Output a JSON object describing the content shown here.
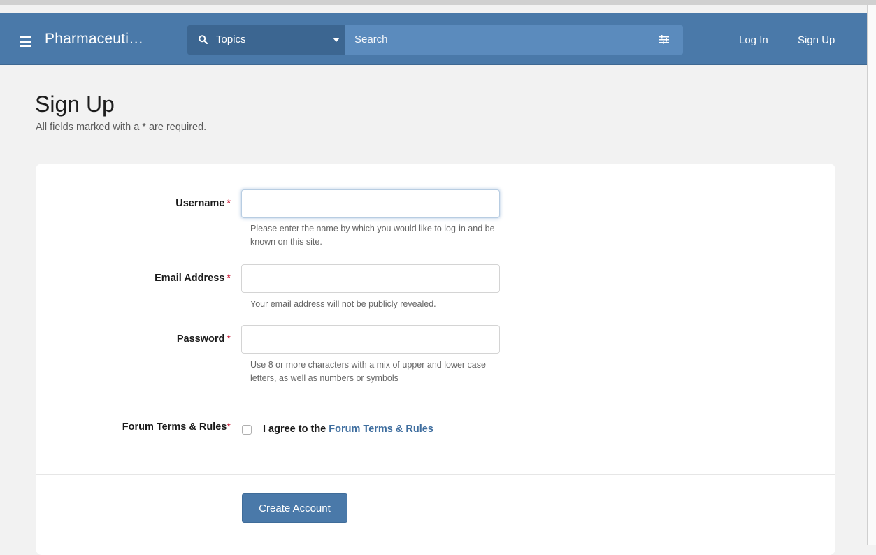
{
  "header": {
    "site_title": "Pharmaceuti…",
    "search_scope": "Topics",
    "search_placeholder": "Search",
    "login_label": "Log In",
    "signup_label": "Sign Up"
  },
  "page": {
    "title": "Sign Up",
    "description": "All fields marked with a * are required."
  },
  "form": {
    "required_marker": "*",
    "username": {
      "label": "Username",
      "value": "",
      "hint": "Please enter the name by which you would like to log-in and be known on this site."
    },
    "email": {
      "label": "Email Address",
      "value": "",
      "hint": "Your email address will not be publicly revealed."
    },
    "password": {
      "label": "Password",
      "value": "",
      "hint": "Use 8 or more characters with a mix of upper and lower case letters, as well as numbers or symbols"
    },
    "terms": {
      "label": "Forum Terms & Rules",
      "agree_prefix": "I agree to the",
      "agree_link": "Forum Terms & Rules",
      "checked": false
    },
    "submit_label": "Create Account"
  },
  "colors": {
    "nav_bg": "#4a79a9",
    "search_bg": "#5b8bbd",
    "topics_bg": "#3c6691",
    "link": "#3f6e9f",
    "required": "#c8102e"
  }
}
